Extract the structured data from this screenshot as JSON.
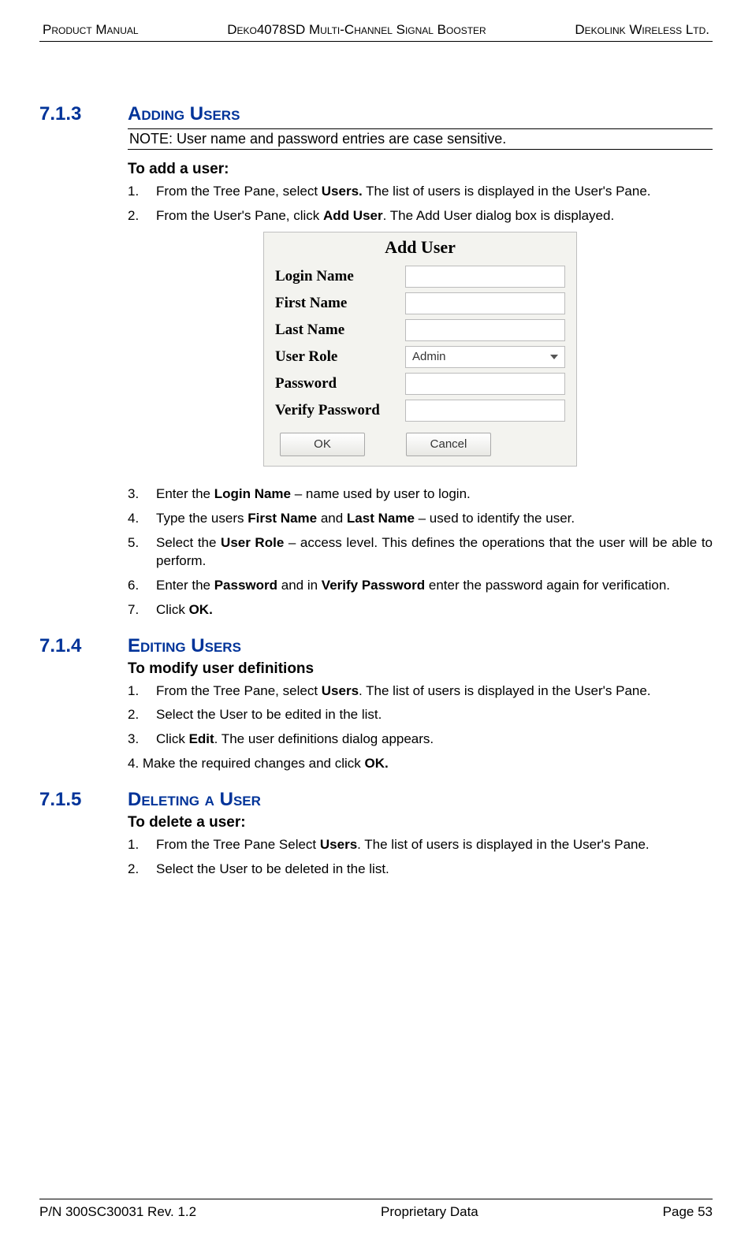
{
  "header": {
    "left": "Product Manual",
    "center": "Deko4078SD Multi-Channel Signal Booster",
    "right": "Dekolink Wireless Ltd."
  },
  "sections": {
    "s713": {
      "num": "7.1.3",
      "title": "Adding Users"
    },
    "s714": {
      "num": "7.1.4",
      "title": "Editing Users"
    },
    "s715": {
      "num": "7.1.5",
      "title": "Deleting a User"
    }
  },
  "note": "NOTE: User name and password entries are case sensitive.",
  "add": {
    "heading": "To add a user:",
    "step1a": "From the Tree Pane, select ",
    "step1b": "Users.",
    "step1c": " The list of users is displayed in the User's Pane.",
    "step2a": "From the User's Pane, click ",
    "step2b": "Add User",
    "step2c": ". The Add User dialog box is displayed.",
    "step3a": "Enter the ",
    "step3b": "Login Name",
    "step3c": " – name used by user to login.",
    "step4a": "Type the users ",
    "step4b": "First Name",
    "step4c": " and ",
    "step4d": "Last Name",
    "step4e": " – used to identify the user.",
    "step5a": "Select the ",
    "step5b": "User Role",
    "step5c": " – access level. This defines the operations that the user will be able to perform.",
    "step6a": "Enter the ",
    "step6b": "Password",
    "step6c": " and in ",
    "step6d": "Verify Password",
    "step6e": " enter the password again for verification.",
    "step7a": "Click ",
    "step7b": "OK."
  },
  "dialog": {
    "title": "Add User",
    "login": "Login Name",
    "first": "First Name",
    "last": "Last Name",
    "role_label": "User Role",
    "role_value": "Admin",
    "password": "Password",
    "verify": "Verify Password",
    "ok": "OK",
    "cancel": "Cancel"
  },
  "edit": {
    "heading": "To modify user definitions",
    "step1a": "From the Tree Pane, select ",
    "step1b": "Users",
    "step1c": ". The list of users is displayed in the User's Pane.",
    "step2": "Select the User to be edited in the list.",
    "step3a": "Click ",
    "step3b": "Edit",
    "step3c": ". The user definitions dialog appears.",
    "step4a": "4.  Make the required changes and click ",
    "step4b": "OK."
  },
  "del": {
    "heading": "To delete a user:",
    "step1a": "From the Tree Pane Select ",
    "step1b": "Users",
    "step1c": ". The list of users is displayed in the User's Pane.",
    "step2": "Select the User to be deleted in the list."
  },
  "footer": {
    "left": "P/N 300SC30031 Rev. 1.2",
    "center": "Proprietary Data",
    "right": "Page 53"
  }
}
